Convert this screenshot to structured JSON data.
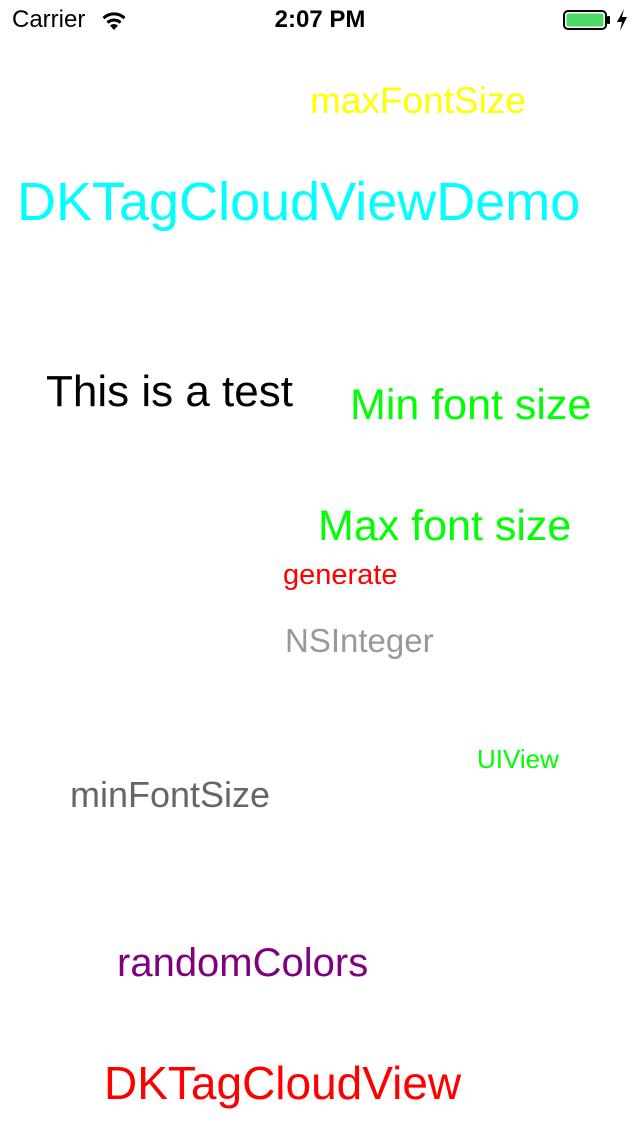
{
  "status_bar": {
    "carrier": "Carrier",
    "time": "2:07 PM",
    "wifi_icon": "wifi-icon",
    "battery_icon": "battery-icon",
    "battery_level": 1.0,
    "battery_color": "#4cd964",
    "charging_icon": "charging-bolt-icon"
  },
  "tag_cloud": {
    "tags": [
      {
        "text": "maxFontSize",
        "color": "#ffff00"
      },
      {
        "text": "DKTagCloudViewDemo",
        "color": "#00ffff"
      },
      {
        "text": "This is a test",
        "color": "#000000"
      },
      {
        "text": "Min font size",
        "color": "#00ff00"
      },
      {
        "text": "Max font size",
        "color": "#00ff00"
      },
      {
        "text": "generate",
        "color": "#ff0000"
      },
      {
        "text": "NSInteger",
        "color": "#999999"
      },
      {
        "text": "UIView",
        "color": "#00ff00"
      },
      {
        "text": "minFontSize",
        "color": "#666666"
      },
      {
        "text": "randomColors",
        "color": "#800080"
      },
      {
        "text": "DKTagCloudView",
        "color": "#ff0000"
      }
    ]
  }
}
